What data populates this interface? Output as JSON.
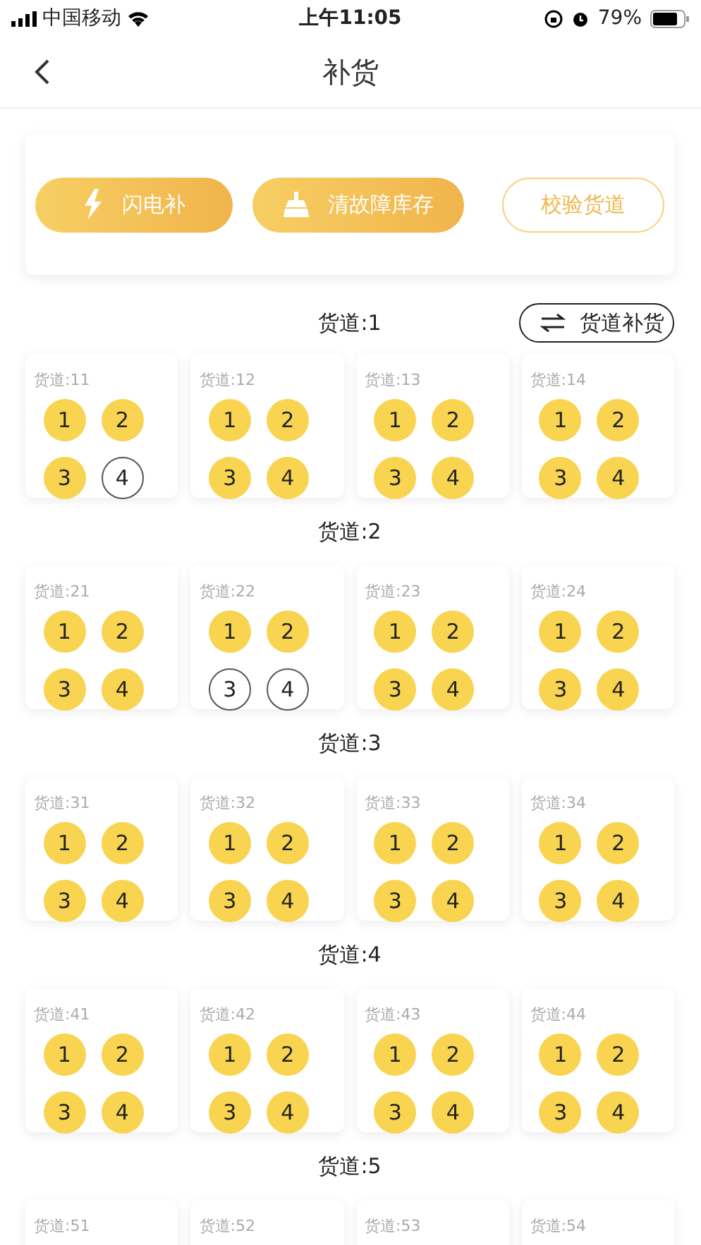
{
  "status_bar": {
    "carrier": "中国移动",
    "time": "上午11:05",
    "battery": "79%"
  },
  "nav": {
    "title": "补货"
  },
  "actions": [
    {
      "label": "闪电补",
      "kind": "lightning"
    },
    {
      "label": "清故障库存",
      "kind": "broom"
    },
    {
      "label": "校验货道",
      "kind": "outline"
    }
  ],
  "groups": [
    {
      "title": "货道:1",
      "swap_button": "货道补货",
      "cards": [
        {
          "label": "货道:11",
          "slots": [
            {
              "number": "1",
              "filled": true
            },
            {
              "number": "2",
              "filled": true
            },
            {
              "number": "3",
              "filled": true
            },
            {
              "number": "4",
              "filled": false
            }
          ]
        },
        {
          "label": "货道:12",
          "slots": [
            {
              "number": "1",
              "filled": true
            },
            {
              "number": "2",
              "filled": true
            },
            {
              "number": "3",
              "filled": true
            },
            {
              "number": "4",
              "filled": true
            }
          ]
        },
        {
          "label": "货道:13",
          "slots": [
            {
              "number": "1",
              "filled": true
            },
            {
              "number": "2",
              "filled": true
            },
            {
              "number": "3",
              "filled": true
            },
            {
              "number": "4",
              "filled": true
            }
          ]
        },
        {
          "label": "货道:14",
          "slots": [
            {
              "number": "1",
              "filled": true
            },
            {
              "number": "2",
              "filled": true
            },
            {
              "number": "3",
              "filled": true
            },
            {
              "number": "4",
              "filled": true
            }
          ]
        }
      ]
    },
    {
      "title": "货道:2",
      "cards": [
        {
          "label": "货道:21",
          "slots": [
            {
              "number": "1",
              "filled": true
            },
            {
              "number": "2",
              "filled": true
            },
            {
              "number": "3",
              "filled": true
            },
            {
              "number": "4",
              "filled": true
            }
          ]
        },
        {
          "label": "货道:22",
          "slots": [
            {
              "number": "1",
              "filled": true
            },
            {
              "number": "2",
              "filled": true
            },
            {
              "number": "3",
              "filled": false
            },
            {
              "number": "4",
              "filled": false
            }
          ]
        },
        {
          "label": "货道:23",
          "slots": [
            {
              "number": "1",
              "filled": true
            },
            {
              "number": "2",
              "filled": true
            },
            {
              "number": "3",
              "filled": true
            },
            {
              "number": "4",
              "filled": true
            }
          ]
        },
        {
          "label": "货道:24",
          "slots": [
            {
              "number": "1",
              "filled": true
            },
            {
              "number": "2",
              "filled": true
            },
            {
              "number": "3",
              "filled": true
            },
            {
              "number": "4",
              "filled": true
            }
          ]
        }
      ]
    },
    {
      "title": "货道:3",
      "cards": [
        {
          "label": "货道:31",
          "slots": [
            {
              "number": "1",
              "filled": true
            },
            {
              "number": "2",
              "filled": true
            },
            {
              "number": "3",
              "filled": true
            },
            {
              "number": "4",
              "filled": true
            }
          ]
        },
        {
          "label": "货道:32",
          "slots": [
            {
              "number": "1",
              "filled": true
            },
            {
              "number": "2",
              "filled": true
            },
            {
              "number": "3",
              "filled": true
            },
            {
              "number": "4",
              "filled": true
            }
          ]
        },
        {
          "label": "货道:33",
          "slots": [
            {
              "number": "1",
              "filled": true
            },
            {
              "number": "2",
              "filled": true
            },
            {
              "number": "3",
              "filled": true
            },
            {
              "number": "4",
              "filled": true
            }
          ]
        },
        {
          "label": "货道:34",
          "slots": [
            {
              "number": "1",
              "filled": true
            },
            {
              "number": "2",
              "filled": true
            },
            {
              "number": "3",
              "filled": true
            },
            {
              "number": "4",
              "filled": true
            }
          ]
        }
      ]
    },
    {
      "title": "货道:4",
      "cards": [
        {
          "label": "货道:41",
          "slots": [
            {
              "number": "1",
              "filled": true
            },
            {
              "number": "2",
              "filled": true
            },
            {
              "number": "3",
              "filled": true
            },
            {
              "number": "4",
              "filled": true
            }
          ]
        },
        {
          "label": "货道:42",
          "slots": [
            {
              "number": "1",
              "filled": true
            },
            {
              "number": "2",
              "filled": true
            },
            {
              "number": "3",
              "filled": true
            },
            {
              "number": "4",
              "filled": true
            }
          ]
        },
        {
          "label": "货道:43",
          "slots": [
            {
              "number": "1",
              "filled": true
            },
            {
              "number": "2",
              "filled": true
            },
            {
              "number": "3",
              "filled": true
            },
            {
              "number": "4",
              "filled": true
            }
          ]
        },
        {
          "label": "货道:44",
          "slots": [
            {
              "number": "1",
              "filled": true
            },
            {
              "number": "2",
              "filled": true
            },
            {
              "number": "3",
              "filled": true
            },
            {
              "number": "4",
              "filled": true
            }
          ]
        }
      ]
    },
    {
      "title": "货道:5",
      "cards": [
        {
          "label": "货道:51"
        },
        {
          "label": "货道:52"
        },
        {
          "label": "货道:53"
        },
        {
          "label": "货道:54"
        }
      ]
    }
  ]
}
